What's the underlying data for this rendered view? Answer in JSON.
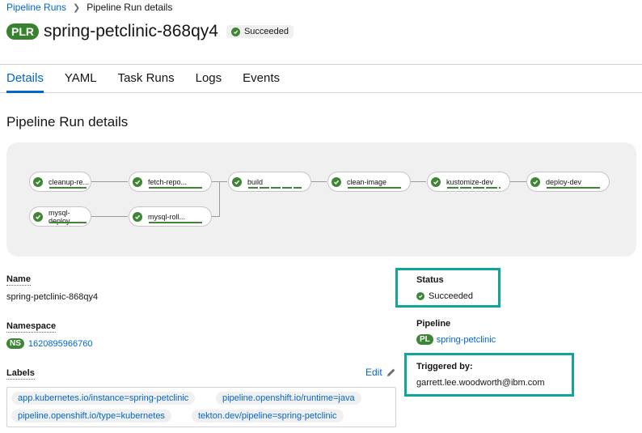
{
  "breadcrumb": {
    "parent": "Pipeline Runs",
    "current": "Pipeline Run details"
  },
  "header": {
    "badge": "PLR",
    "title": "spring-petclinic-868qy4",
    "status": "Succeeded"
  },
  "tabs": [
    {
      "label": "Details",
      "active": true
    },
    {
      "label": "YAML"
    },
    {
      "label": "Task Runs"
    },
    {
      "label": "Logs"
    },
    {
      "label": "Events"
    }
  ],
  "section_title": "Pipeline Run details",
  "graph": {
    "nodes": [
      {
        "name": "cleanup-re...",
        "status": "succeeded"
      },
      {
        "name": "fetch-repo...",
        "status": "succeeded"
      },
      {
        "name": "build",
        "status": "succeeded"
      },
      {
        "name": "clean-image",
        "status": "succeeded"
      },
      {
        "name": "kustomize-dev",
        "status": "succeeded"
      },
      {
        "name": "deploy-dev",
        "status": "succeeded"
      },
      {
        "name": "mysql-deploy",
        "status": "succeeded"
      },
      {
        "name": "mysql-roll...",
        "status": "succeeded"
      }
    ]
  },
  "details": {
    "name_label": "Name",
    "name_value": "spring-petclinic-868qy4",
    "namespace_label": "Namespace",
    "namespace_badge": "NS",
    "namespace_value": "1620895966760",
    "labels_label": "Labels",
    "edit_label": "Edit",
    "labels": [
      "app.kubernetes.io/instance=spring-petclinic",
      "pipeline.openshift.io/runtime=java",
      "pipeline.openshift.io/type=kubernetes",
      "tekton.dev/pipeline=spring-petclinic"
    ],
    "status_label": "Status",
    "status_value": "Succeeded",
    "pipeline_label": "Pipeline",
    "pipeline_badge": "PL",
    "pipeline_value": "spring-petclinic",
    "triggered_label": "Triggered by:",
    "triggered_value": "garrett.lee.woodworth@ibm.com"
  },
  "colors": {
    "success": "#3e8635",
    "link": "#0066cc",
    "highlight": "#0fa699"
  }
}
